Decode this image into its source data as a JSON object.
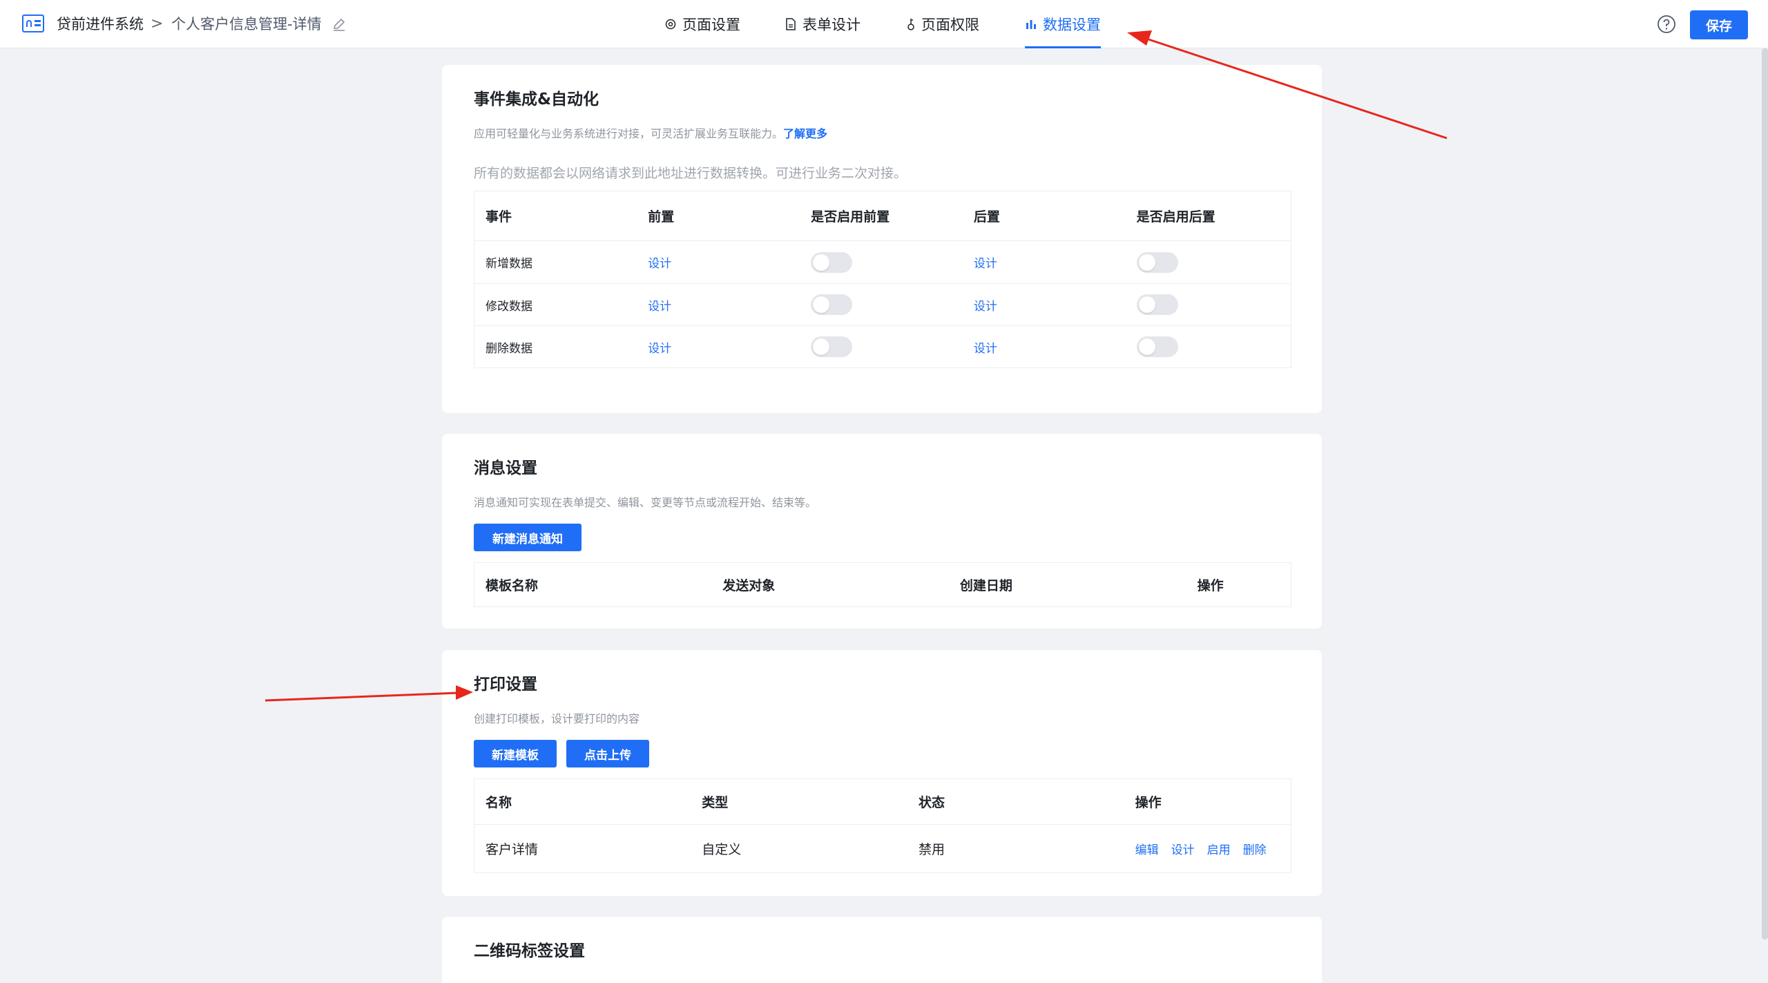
{
  "topbar": {
    "app_name": "贷前进件系统",
    "separator": ">",
    "page_name": "个人客户信息管理-详情",
    "save_label": "保存"
  },
  "tabs": [
    {
      "label": "页面设置",
      "icon": "gear-icon"
    },
    {
      "label": "表单设计",
      "icon": "document-icon"
    },
    {
      "label": "页面权限",
      "icon": "key-icon"
    },
    {
      "label": "数据设置",
      "icon": "bar-chart-icon",
      "active": true
    }
  ],
  "events": {
    "title": "事件集成&自动化",
    "desc": "应用可轻量化与业务系统进行对接，可灵活扩展业务互联能力。",
    "learn_more": "了解更多",
    "desc2": "所有的数据都会以网络请求到此地址进行数据转换。可进行业务二次对接。",
    "columns": [
      "事件",
      "前置",
      "是否启用前置",
      "后置",
      "是否启用后置"
    ],
    "rows": [
      {
        "event": "新增数据",
        "pre": "设计",
        "post": "设计"
      },
      {
        "event": "修改数据",
        "pre": "设计",
        "post": "设计"
      },
      {
        "event": "删除数据",
        "pre": "设计",
        "post": "设计"
      }
    ]
  },
  "messages": {
    "title": "消息设置",
    "desc": "消息通知可实现在表单提交、编辑、变更等节点或流程开始、结束等。",
    "new_button": "新建消息通知",
    "columns": [
      "模板名称",
      "发送对象",
      "创建日期",
      "操作"
    ]
  },
  "print": {
    "title": "打印设置",
    "desc": "创建打印模板，设计要打印的内容",
    "new_template": "新建模板",
    "upload": "点击上传",
    "columns": [
      "名称",
      "类型",
      "状态",
      "操作"
    ],
    "rows": [
      {
        "name": "客户详情",
        "type": "自定义",
        "status": "禁用",
        "ops": [
          "编辑",
          "设计",
          "启用",
          "删除"
        ]
      }
    ]
  },
  "qrcode": {
    "title": "二维码标签设置"
  },
  "colors": {
    "accent": "#1f6ef5",
    "annotation_arrow": "#e8261c"
  }
}
